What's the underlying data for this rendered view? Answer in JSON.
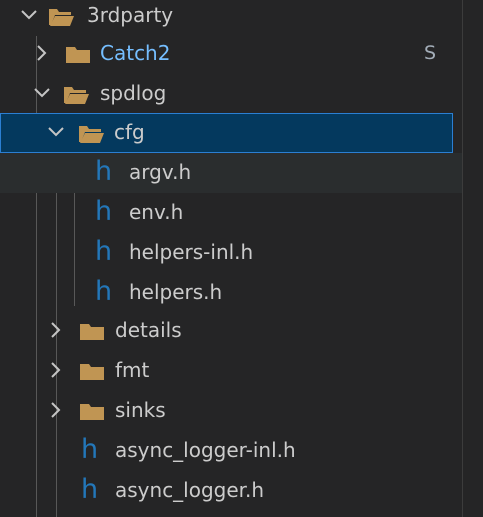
{
  "explorer": {
    "items": [
      {
        "label": "3rdparty",
        "icon": "folder-open-icon",
        "expanded": true
      },
      {
        "label": "Catch2",
        "icon": "folder-icon",
        "expanded": false,
        "badge": "S",
        "label_color": "#75beff"
      },
      {
        "label": "spdlog",
        "icon": "folder-open-icon",
        "expanded": true
      },
      {
        "label": "cfg",
        "icon": "folder-open-icon",
        "expanded": true,
        "selected": true
      },
      {
        "label": "argv.h",
        "icon": "h-file-icon"
      },
      {
        "label": "env.h",
        "icon": "h-file-icon"
      },
      {
        "label": "helpers-inl.h",
        "icon": "h-file-icon"
      },
      {
        "label": "helpers.h",
        "icon": "h-file-icon"
      },
      {
        "label": "details",
        "icon": "folder-icon",
        "expanded": false
      },
      {
        "label": "fmt",
        "icon": "folder-icon",
        "expanded": false
      },
      {
        "label": "sinks",
        "icon": "folder-icon",
        "expanded": false
      },
      {
        "label": "async_logger-inl.h",
        "icon": "h-file-icon"
      },
      {
        "label": "async_logger.h",
        "icon": "h-file-icon"
      }
    ],
    "header_file_glyph": "h"
  },
  "colors": {
    "background": "#252526",
    "selection": "#04395e",
    "selection_border": "#2b7fd3",
    "folder": "#c09553",
    "header_icon": "#2377b9",
    "untracked_label": "#75beff"
  }
}
